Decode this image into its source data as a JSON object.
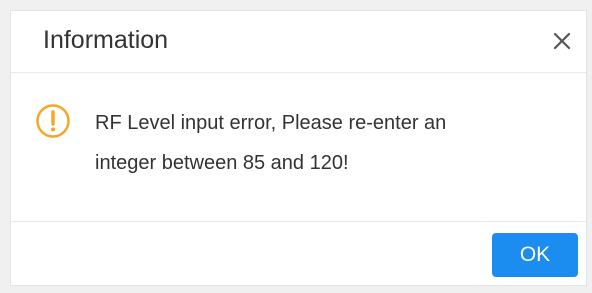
{
  "dialog": {
    "title": "Information",
    "close_icon": "close-icon",
    "message_icon": "warning-icon",
    "message_line_1": "RF Level input error, Please re-enter an",
    "message_line_2": "integer between 85 and 120!",
    "ok_label": "OK"
  },
  "colors": {
    "warning": "#f5a623",
    "primary_button": "#1b8cf0"
  }
}
